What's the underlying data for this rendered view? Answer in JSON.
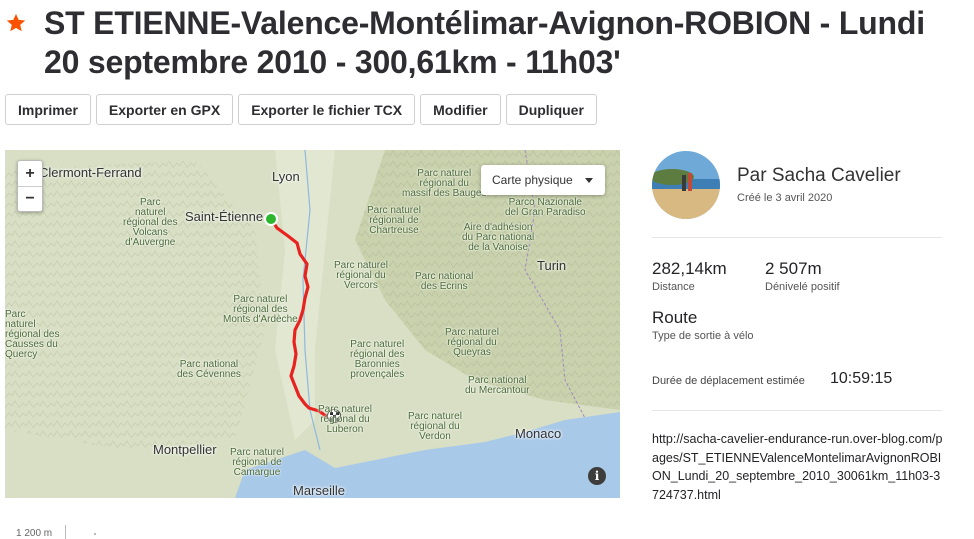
{
  "title": "ST ETIENNE-Valence-Montélimar-Avignon-ROBION - Lundi 20 septembre 2010 - 300,61km - 11h03'",
  "accent_color": "#fc5200",
  "actions": [
    "Imprimer",
    "Exporter en GPX",
    "Exporter le fichier TCX",
    "Modifier",
    "Dupliquer"
  ],
  "map": {
    "type_label": "Carte physique",
    "zoom_in": "+",
    "zoom_out": "−",
    "info": "i",
    "cities": {
      "clermont": "Clermont-Ferrand",
      "lyon": "Lyon",
      "saint_etienne": "Saint-Étienne",
      "turin": "Turin",
      "montpellier": "Montpellier",
      "monaco": "Monaco",
      "marseille": "Marseille"
    },
    "parks": {
      "volcans": "Parc\nnaturel\nrégional des\nVolcans\nd'Auvergne",
      "bauges": "Parc naturel\nrégional du\nmassif des Bauges",
      "gran_paradiso": "Parco Nazionale\ndel Gran Paradiso",
      "chartreuse": "Parc naturel\nrégional de\nChartreuse",
      "vanoise": "Aire d'adhésion\ndu Parc national\nde la Vanoise",
      "vercors": "Parc naturel\nrégional du\nVercors",
      "ecrins": "Parc national\ndes Ecrins",
      "ardeche": "Parc naturel\nrégional des\nMonts d'Ardèche",
      "causses": "Parc\nnaturel\nrégional des\nCausses du\nQuercy",
      "cevennes": "Parc national\ndes Cévennes",
      "queyras": "Parc naturel\nrégional du\nQueyras",
      "baronnies": "Parc naturel\nrégional des\nBaronnies\nprovençales",
      "mercantour": "Parc national\ndu Mercantour",
      "luberon": "Parc naturel\nrégional du\nLuberon",
      "verdon": "Parc naturel\nrégional du\nVerdon",
      "camargue": "Parc naturel\nrégional de\nCamargue"
    }
  },
  "author": {
    "name": "Par Sacha Cavelier",
    "created": "Créé le 3 avril 2020"
  },
  "stats": {
    "distance_value": "282,14km",
    "distance_label": "Distance",
    "elevation_value": "2 507m",
    "elevation_label": "Dénivelé positif",
    "type_value": "Route",
    "type_label": "Type de sortie à vélo",
    "duration_label": "Durée de déplacement estimée",
    "duration_value": "10:59:15"
  },
  "description": "http://sacha-cavelier-endurance-run.over-blog.com/pages/ST_ETIENNEValenceMontelimarAvignonROBION_Lundi_20_septembre_2010_30061km_11h03-3724737.html",
  "elevation_chart": {
    "tick_label": "1 200 m"
  }
}
